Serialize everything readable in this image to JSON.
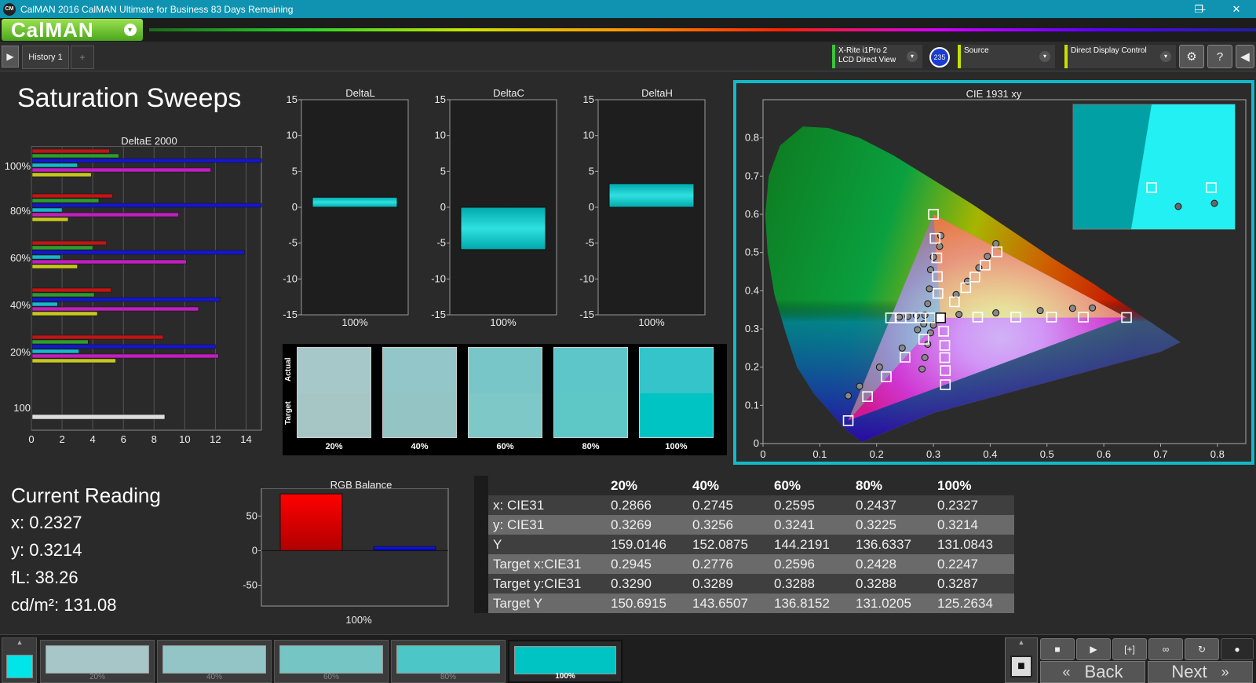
{
  "window": {
    "title": "CalMAN 2016 CalMAN Ultimate for Business 83 Days Remaining",
    "app_logo": "CM",
    "min": "—",
    "max": "❐",
    "close": "✕"
  },
  "brand": {
    "label": "CalMAN",
    "dropdown": "▾"
  },
  "toolbar": {
    "history_tab": "History 1",
    "add_tab": "+",
    "meter": {
      "line1": "X-Rite i1Pro 2",
      "line2": "LCD Direct View"
    },
    "meter_badge": "235",
    "source": "Source",
    "display_control": "Direct Display Control",
    "chevron": "▾",
    "settings_icon": "⚙",
    "help_icon": "?",
    "collapse_icon": "◀",
    "play_icon": "▶"
  },
  "page_title": "Saturation Sweeps",
  "colors": {
    "accent": "#11b9c9",
    "cyan": "#00c4c4",
    "brand_green": "#6cc53a",
    "red": "#ff0000",
    "blue": "#1a1aff"
  },
  "chart_data": [
    {
      "id": "deltae",
      "type": "bar",
      "title": "DeltaE 2000",
      "orientation": "horizontal",
      "categories": [
        "100%",
        "80%",
        "60%",
        "40%",
        "20%",
        "100"
      ],
      "xlim": [
        0,
        15
      ],
      "xticks": [
        0,
        2,
        4,
        6,
        8,
        10,
        12,
        14
      ],
      "series": [
        {
          "color": "#c01616",
          "values": [
            5.1,
            5.3,
            4.9,
            5.2,
            8.6,
            0
          ]
        },
        {
          "color": "#2e9d2e",
          "values": [
            5.7,
            4.4,
            4.0,
            4.1,
            3.7,
            0
          ]
        },
        {
          "color": "#1616d0",
          "values": [
            15.0,
            15.0,
            13.9,
            12.3,
            12.0,
            0
          ]
        },
        {
          "color": "#16b8c8",
          "values": [
            3.0,
            2.0,
            1.9,
            1.7,
            3.1,
            0
          ]
        },
        {
          "color": "#c01fc0",
          "values": [
            11.7,
            9.6,
            10.1,
            10.9,
            12.2,
            0
          ]
        },
        {
          "color": "#c8c820",
          "values": [
            3.9,
            2.4,
            3.0,
            4.3,
            5.5,
            8.7
          ]
        }
      ]
    },
    {
      "id": "deltal",
      "type": "bar",
      "title": "DeltaL",
      "categories": [
        "100%"
      ],
      "values": [
        1.4
      ],
      "ylim": [
        -15,
        15
      ],
      "yticks": [
        15,
        10,
        5,
        0,
        -5,
        -10,
        -15
      ]
    },
    {
      "id": "deltac",
      "type": "bar",
      "title": "DeltaC",
      "categories": [
        "100%"
      ],
      "values": [
        -5.9
      ],
      "ylim": [
        -15,
        15
      ],
      "yticks": [
        15,
        10,
        5,
        0,
        -5,
        -10,
        -15
      ]
    },
    {
      "id": "deltah",
      "type": "bar",
      "title": "DeltaH",
      "categories": [
        "100%"
      ],
      "values": [
        3.3
      ],
      "ylim": [
        -15,
        15
      ],
      "yticks": [
        15,
        10,
        5,
        0,
        -5,
        -10,
        -15
      ]
    },
    {
      "id": "rgb",
      "type": "bar",
      "title": "RGB Balance",
      "categories": [
        "100%"
      ],
      "series": [
        {
          "color": "#ff0000",
          "values": [
            82
          ]
        },
        {
          "color": "#1a1aff",
          "values": [
            6
          ]
        }
      ],
      "ylim": [
        -80,
        90
      ],
      "yticks": [
        50,
        0,
        -50
      ]
    },
    {
      "id": "cie",
      "type": "scatter",
      "title": "CIE 1931 xy",
      "xlim": [
        0,
        0.85
      ],
      "ylim": [
        0,
        0.9
      ],
      "xticks": [
        0,
        0.1,
        0.2,
        0.3,
        0.4,
        0.5,
        0.6,
        0.7,
        0.8
      ],
      "yticks": [
        0,
        0.1,
        0.2,
        0.3,
        0.4,
        0.5,
        0.6,
        0.7,
        0.8
      ],
      "gamut": [
        [
          0.64,
          0.33
        ],
        [
          0.3,
          0.6
        ],
        [
          0.15,
          0.06
        ]
      ],
      "targets": [
        [
          0.64,
          0.33
        ],
        [
          0.564,
          0.331
        ],
        [
          0.508,
          0.331
        ],
        [
          0.445,
          0.331
        ],
        [
          0.378,
          0.331
        ],
        [
          0.312,
          0.329
        ],
        [
          0.3,
          0.6
        ],
        [
          0.303,
          0.537
        ],
        [
          0.306,
          0.486
        ],
        [
          0.307,
          0.437
        ],
        [
          0.308,
          0.393
        ],
        [
          0.15,
          0.06
        ],
        [
          0.184,
          0.123
        ],
        [
          0.217,
          0.175
        ],
        [
          0.25,
          0.226
        ],
        [
          0.283,
          0.273
        ],
        [
          0.2947,
          0.329
        ],
        [
          0.2779,
          0.329
        ],
        [
          0.2596,
          0.329
        ],
        [
          0.2428,
          0.329
        ],
        [
          0.2247,
          0.329
        ],
        [
          0.412,
          0.502
        ],
        [
          0.391,
          0.467
        ],
        [
          0.373,
          0.436
        ],
        [
          0.357,
          0.408
        ],
        [
          0.337,
          0.371
        ],
        [
          0.321,
          0.154
        ],
        [
          0.321,
          0.191
        ],
        [
          0.32,
          0.225
        ],
        [
          0.32,
          0.257
        ],
        [
          0.318,
          0.294
        ]
      ],
      "measured": [
        [
          0.58,
          0.355
        ],
        [
          0.545,
          0.354
        ],
        [
          0.488,
          0.348
        ],
        [
          0.41,
          0.342
        ],
        [
          0.345,
          0.338
        ],
        [
          0.24,
          0.331
        ],
        [
          0.255,
          0.333
        ],
        [
          0.27,
          0.335
        ],
        [
          0.285,
          0.336
        ],
        [
          0.313,
          0.544
        ],
        [
          0.311,
          0.516
        ],
        [
          0.3,
          0.488
        ],
        [
          0.295,
          0.455
        ],
        [
          0.293,
          0.405
        ],
        [
          0.29,
          0.366
        ],
        [
          0.15,
          0.125
        ],
        [
          0.17,
          0.15
        ],
        [
          0.205,
          0.2
        ],
        [
          0.245,
          0.25
        ],
        [
          0.272,
          0.298
        ],
        [
          0.283,
          0.313
        ],
        [
          0.41,
          0.523
        ],
        [
          0.395,
          0.49
        ],
        [
          0.38,
          0.46
        ],
        [
          0.36,
          0.425
        ],
        [
          0.34,
          0.39
        ],
        [
          0.28,
          0.195
        ],
        [
          0.285,
          0.225
        ],
        [
          0.29,
          0.26
        ],
        [
          0.295,
          0.29
        ],
        [
          0.3,
          0.31
        ]
      ],
      "current": [
        0.3127,
        0.329
      ]
    }
  ],
  "swatches_panel": {
    "actual_label": "Actual",
    "target_label": "Target",
    "items": [
      {
        "label": "20%",
        "actual": "#a7c8c9",
        "target": "#a6c6c6"
      },
      {
        "label": "40%",
        "actual": "#93c6c8",
        "target": "#94c5c4"
      },
      {
        "label": "60%",
        "actual": "#79c6c8",
        "target": "#7ec8c7"
      },
      {
        "label": "80%",
        "actual": "#5cc6c9",
        "target": "#5ec8c6"
      },
      {
        "label": "100%",
        "actual": "#34c4c9",
        "target": "#00c4c4"
      }
    ]
  },
  "current_reading": {
    "heading": "Current Reading",
    "x": "x: 0.2327",
    "y": "y: 0.3214",
    "fl": "fL: 38.26",
    "cdm2": "cd/m²: 131.08"
  },
  "table": {
    "headers": [
      "20%",
      "40%",
      "60%",
      "80%",
      "100%"
    ],
    "rows": [
      {
        "label": "x: CIE31",
        "values": [
          "0.2866",
          "0.2745",
          "0.2595",
          "0.2437",
          "0.2327"
        ]
      },
      {
        "label": "y: CIE31",
        "values": [
          "0.3269",
          "0.3256",
          "0.3241",
          "0.3225",
          "0.3214"
        ]
      },
      {
        "label": "Y",
        "values": [
          "159.0146",
          "152.0875",
          "144.2191",
          "136.6337",
          "131.0843"
        ]
      },
      {
        "label": "Target x:CIE31",
        "values": [
          "0.2945",
          "0.2776",
          "0.2596",
          "0.2428",
          "0.2247"
        ]
      },
      {
        "label": "Target y:CIE31",
        "values": [
          "0.3290",
          "0.3289",
          "0.3288",
          "0.3288",
          "0.3287"
        ]
      },
      {
        "label": "Target Y",
        "values": [
          "150.6915",
          "143.6507",
          "136.8152",
          "131.0205",
          "125.2634"
        ]
      }
    ]
  },
  "bottom": {
    "current_color": "#00e5e8",
    "patches": [
      {
        "label": "20%",
        "color": "#a6c6c7"
      },
      {
        "label": "40%",
        "color": "#93c5c6"
      },
      {
        "label": "60%",
        "color": "#75c5c4"
      },
      {
        "label": "80%",
        "color": "#4cc6c6"
      },
      {
        "label": "100%",
        "color": "#00c4c4"
      }
    ],
    "back": "Back",
    "next": "Next",
    "back_icon": "«",
    "next_icon": "»",
    "up_icon": "▲",
    "stop_icon": "■",
    "play_icon": "▶",
    "measure_icon": "[+]",
    "loop_icon": "∞",
    "refresh_icon": "↻",
    "record_icon": "●"
  }
}
